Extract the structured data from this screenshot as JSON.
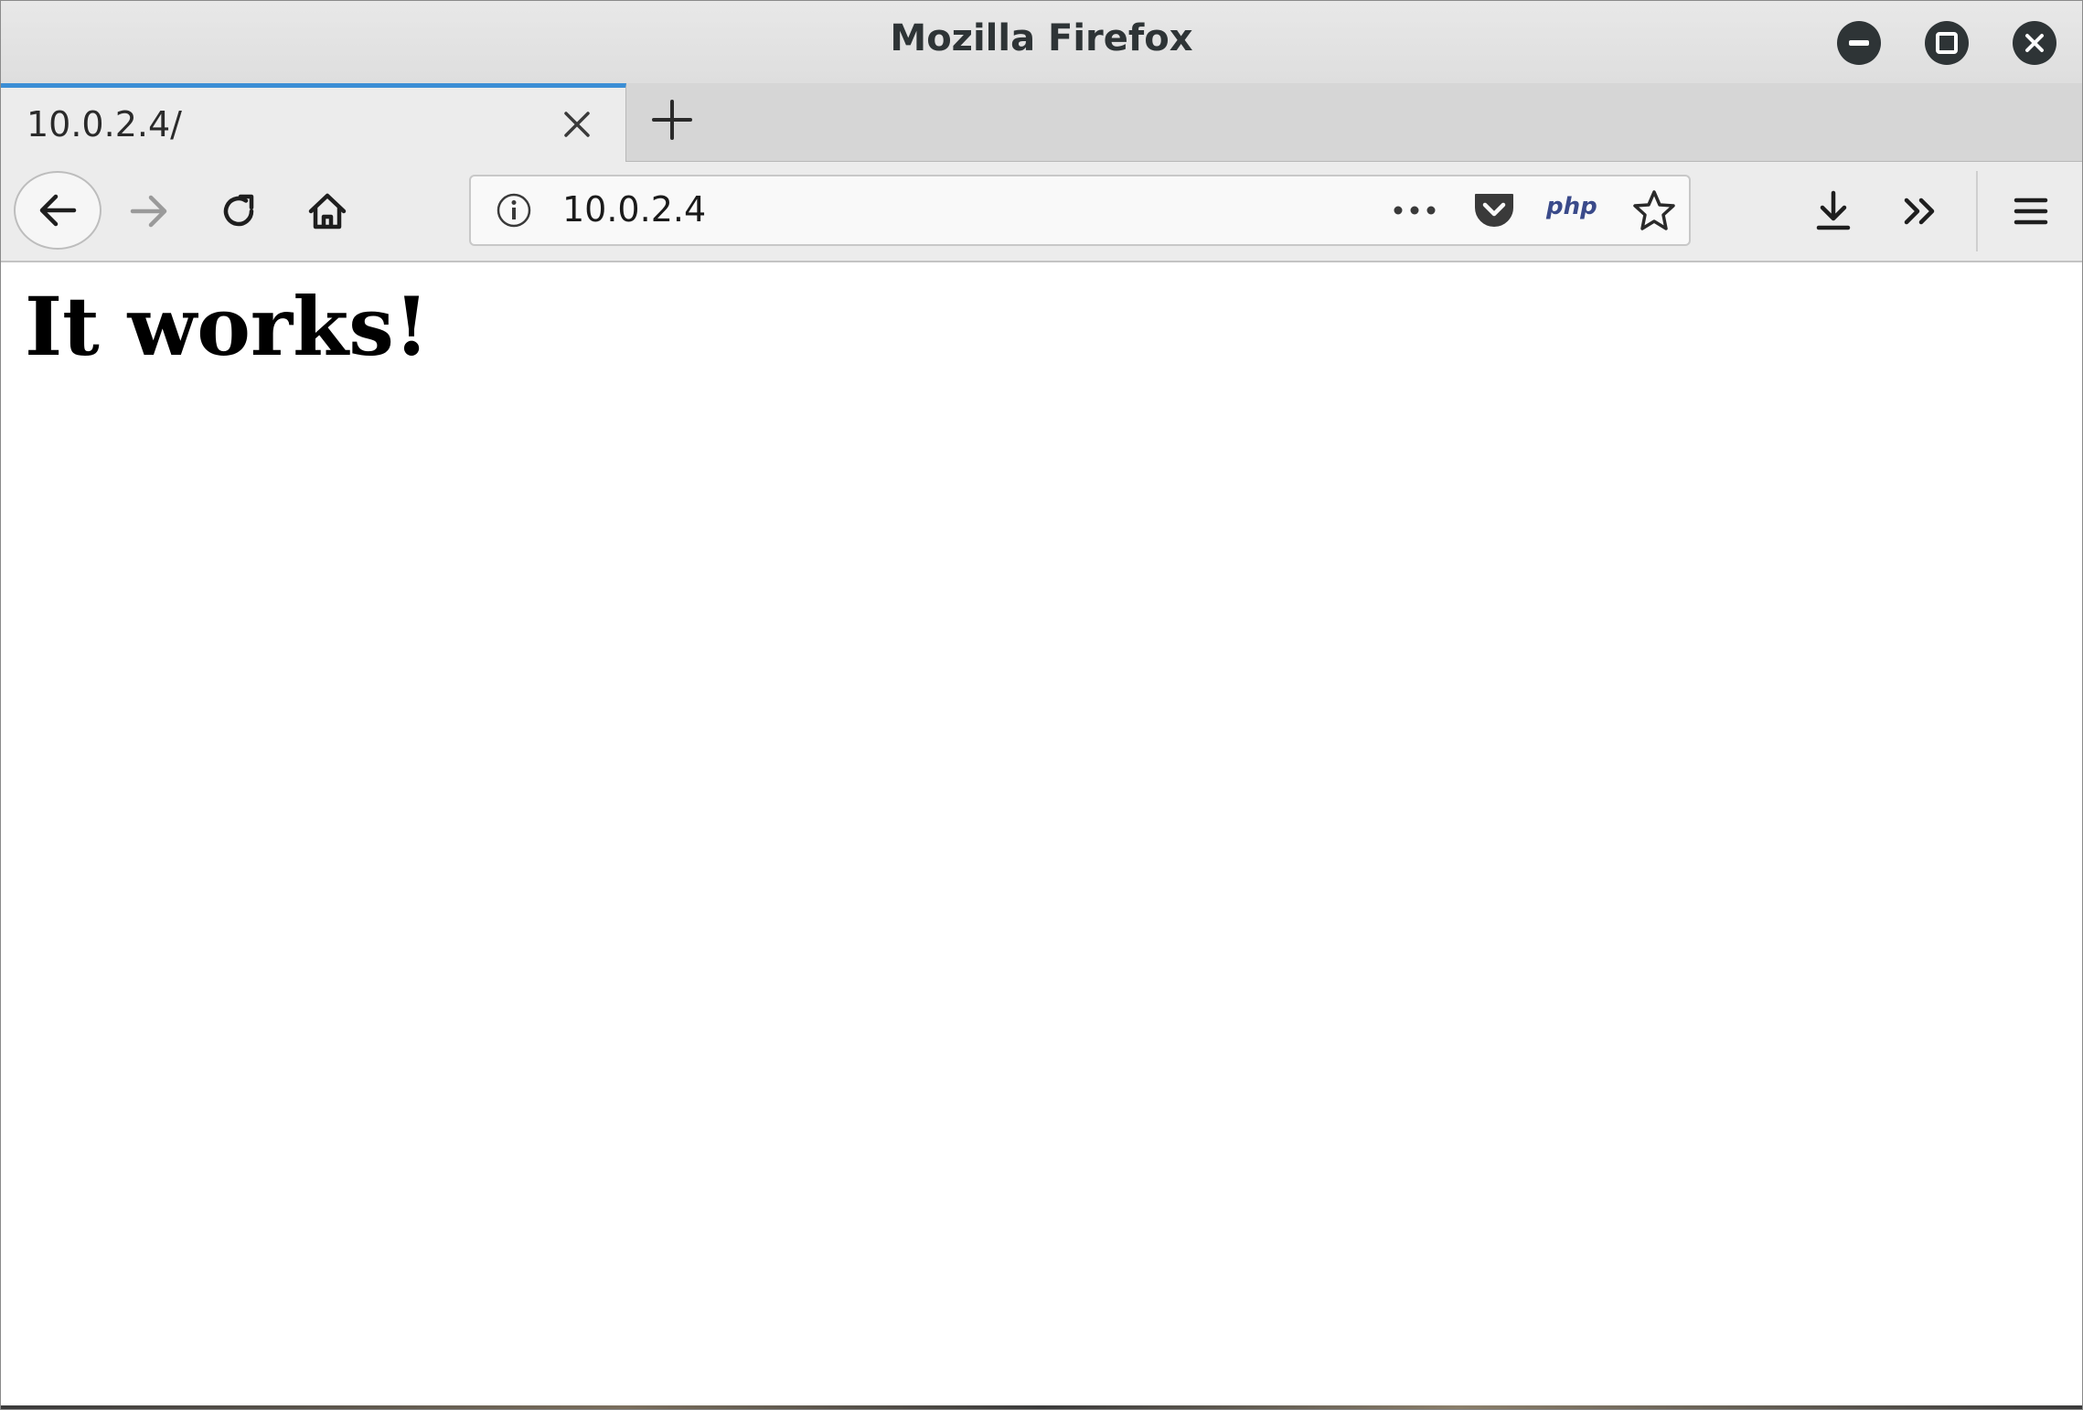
{
  "window": {
    "title": "Mozilla Firefox",
    "controls": {
      "minimize_icon": "minimize-icon",
      "maximize_icon": "maximize-icon",
      "close_icon": "close-icon"
    }
  },
  "tabs": [
    {
      "label": "10.0.2.4/",
      "active": true,
      "close_icon": "close-icon"
    }
  ],
  "new_tab_icon": "plus-icon",
  "navigation": {
    "back_icon": "arrow-left-icon",
    "forward_icon": "arrow-right-icon",
    "reload_icon": "reload-icon",
    "home_icon": "home-icon"
  },
  "urlbar": {
    "info_icon": "info-icon",
    "url": "10.0.2.4",
    "page_actions_icon": "more-icon",
    "pocket_icon": "pocket-icon",
    "php_label": "php",
    "bookmark_icon": "star-icon"
  },
  "toolbar": {
    "downloads_icon": "download-icon",
    "overflow_icon": "chevron-double-right-icon",
    "menu_icon": "hamburger-menu-icon"
  },
  "page": {
    "heading": "It works!"
  },
  "colors": {
    "accent": "#3b8ed5",
    "titlebar": "#e3e3e3",
    "toolbar": "#ececec",
    "tabstrip": "#d6d6d6"
  }
}
